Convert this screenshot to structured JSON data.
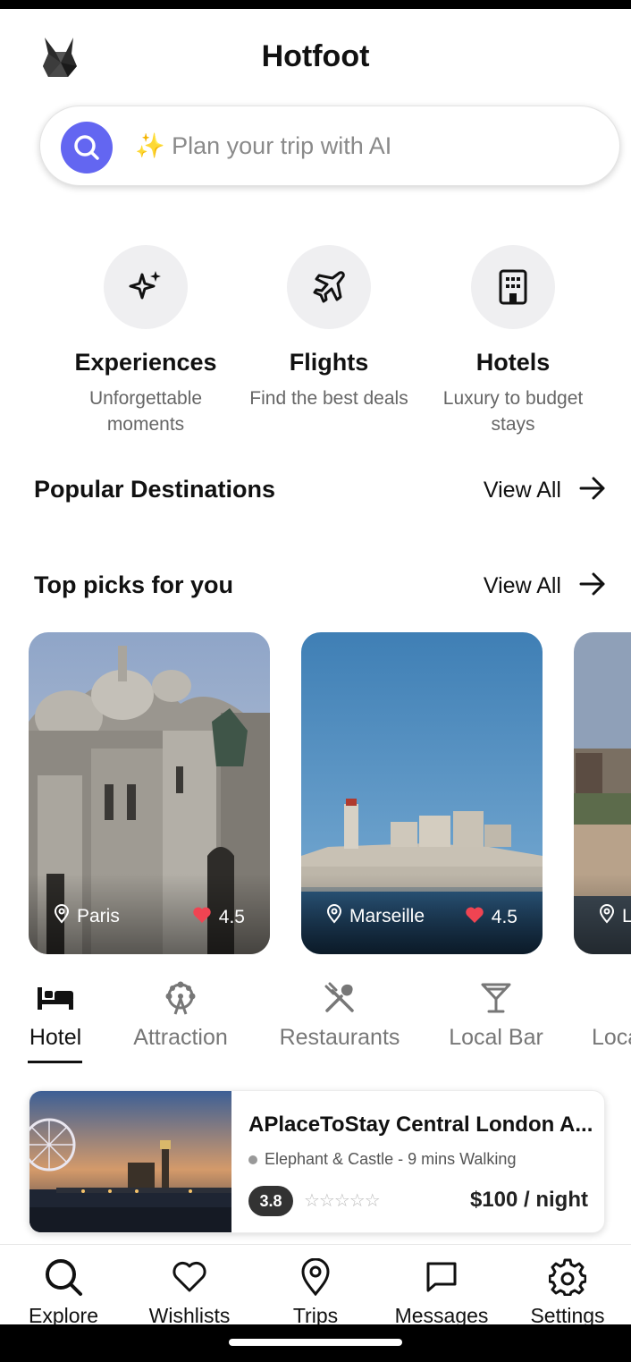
{
  "app": {
    "title": "Hotfoot",
    "logo_icon": "fox-logo-icon"
  },
  "search": {
    "placeholder": "✨ Plan your trip with AI",
    "icon": "search-icon",
    "accent": "#6366f1"
  },
  "categories": [
    {
      "title": "Experiences",
      "subtitle": "Unforgettable moments",
      "icon": "sparkles-icon"
    },
    {
      "title": "Flights",
      "subtitle": "Find the best deals",
      "icon": "airplane-icon"
    },
    {
      "title": "Hotels",
      "subtitle": "Luxury to budget stays",
      "icon": "building-icon"
    }
  ],
  "popular": {
    "title": "Popular Destinations",
    "view_all": "View All"
  },
  "top_picks": {
    "title": "Top picks for you",
    "view_all": "View All",
    "cards": [
      {
        "city": "Paris",
        "rating": "4.5"
      },
      {
        "city": "Marseille",
        "rating": "4.5"
      },
      {
        "city": "L"
      }
    ]
  },
  "tabs": [
    {
      "label": "Hotel",
      "icon": "bed-icon",
      "active": true
    },
    {
      "label": "Attraction",
      "icon": "ferris-wheel-icon"
    },
    {
      "label": "Restaurants",
      "icon": "utensils-icon"
    },
    {
      "label": "Local Bar",
      "icon": "cocktail-icon"
    },
    {
      "label": "Loca"
    }
  ],
  "hotel": {
    "name": "APlaceToStay Central London A...",
    "location": "Elephant & Castle - 9 mins Walking",
    "rating": "3.8",
    "price": "$100 / night"
  },
  "nav": [
    {
      "label": "Explore",
      "icon": "search-icon"
    },
    {
      "label": "Wishlists",
      "icon": "heart-icon"
    },
    {
      "label": "Trips",
      "icon": "map-pin-icon"
    },
    {
      "label": "Messages",
      "icon": "message-icon"
    },
    {
      "label": "Settings",
      "icon": "gear-icon"
    }
  ]
}
